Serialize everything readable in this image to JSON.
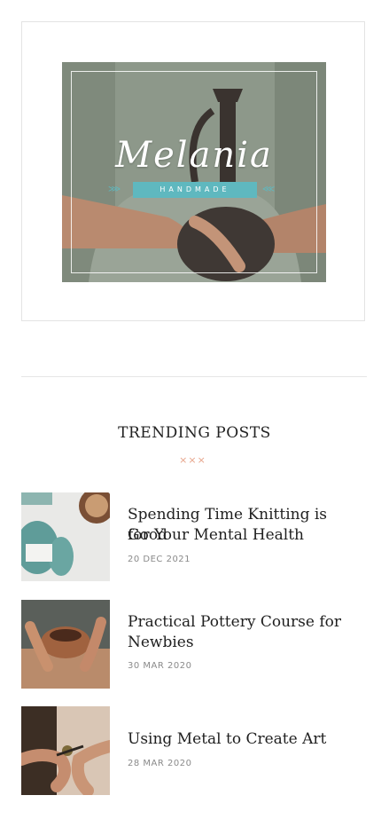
{
  "banner": {
    "logo_script": "Melania",
    "logo_ribbon": "HANDMADE",
    "arrows_left": "⋙",
    "arrows_right": "⋘"
  },
  "trending": {
    "title": "TRENDING POSTS",
    "decoration": "×××",
    "posts": [
      {
        "title_line1": "Spending Time Knitting is Good",
        "title_line2": "for Your Mental Health",
        "date": "20 DEC 2021"
      },
      {
        "title_line1": "Practical Pottery Course for",
        "title_line2": "Newbies",
        "date": "30 MAR 2020"
      },
      {
        "title_line1": "Using Metal to Create Art",
        "title_line2": "",
        "date": "28 MAR 2020"
      }
    ]
  },
  "colors": {
    "accent": "#e7a48a",
    "ribbon": "#5fb8bf"
  },
  "icons": {
    "thumb_1": "knitting-yarn-image",
    "thumb_2": "pottery-hands-image",
    "thumb_3": "metal-art-image"
  }
}
